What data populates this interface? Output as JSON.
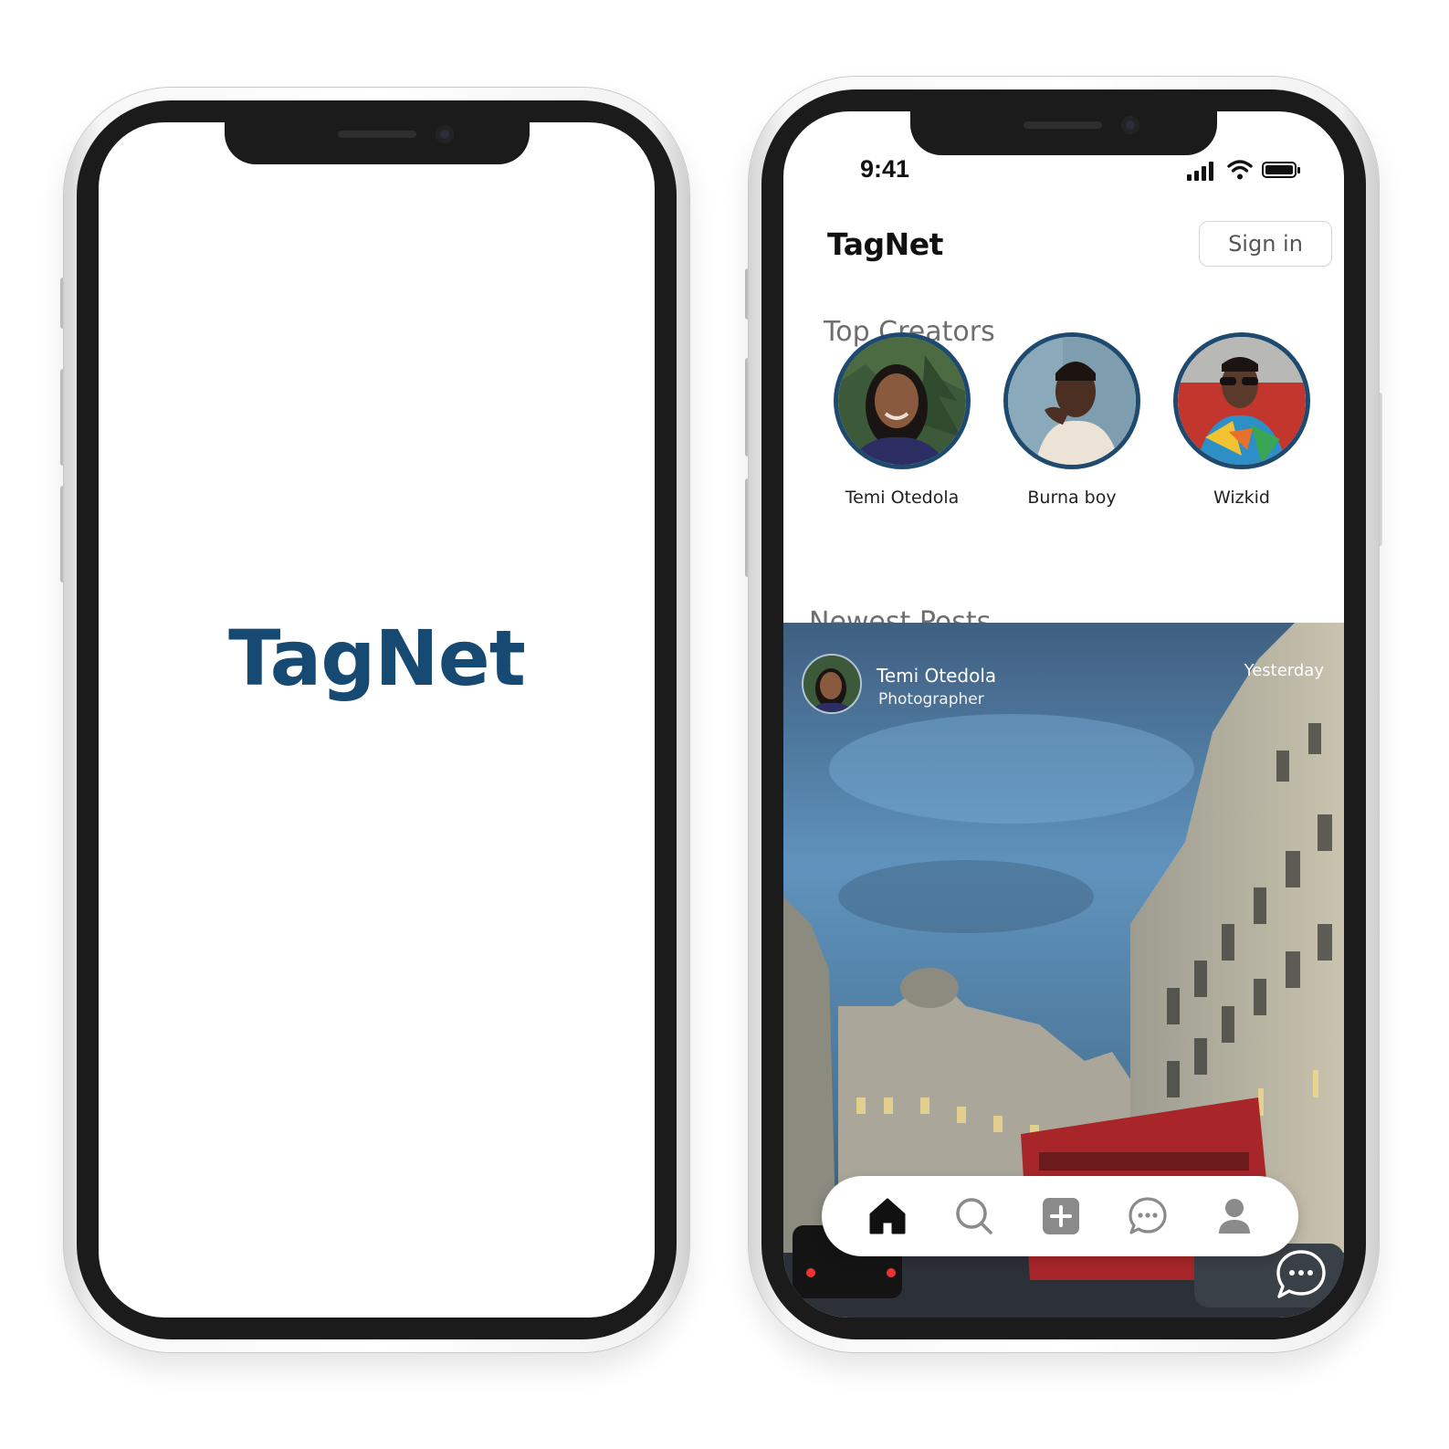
{
  "splash": {
    "app_name": "TagNet"
  },
  "home": {
    "status_bar": {
      "time": "9:41"
    },
    "app_name": "TagNet",
    "sign_in_label": "Sign in",
    "top_creators_title": "Top Creators",
    "creators": [
      {
        "name": "Temi Otedola"
      },
      {
        "name": "Burna boy"
      },
      {
        "name": "Wizkid"
      }
    ],
    "newest_posts_title": "Newest Posts",
    "post": {
      "author": "Temi Otedola",
      "role": "Photographer",
      "time": "Yesterday"
    },
    "nav": [
      {
        "icon": "home-icon",
        "active": true
      },
      {
        "icon": "search-icon",
        "active": false
      },
      {
        "icon": "add-post-icon",
        "active": false
      },
      {
        "icon": "messages-icon",
        "active": false
      },
      {
        "icon": "profile-icon",
        "active": false
      }
    ]
  },
  "colors": {
    "brand": "#174a73",
    "avatar_ring": "#1d4a6e"
  }
}
